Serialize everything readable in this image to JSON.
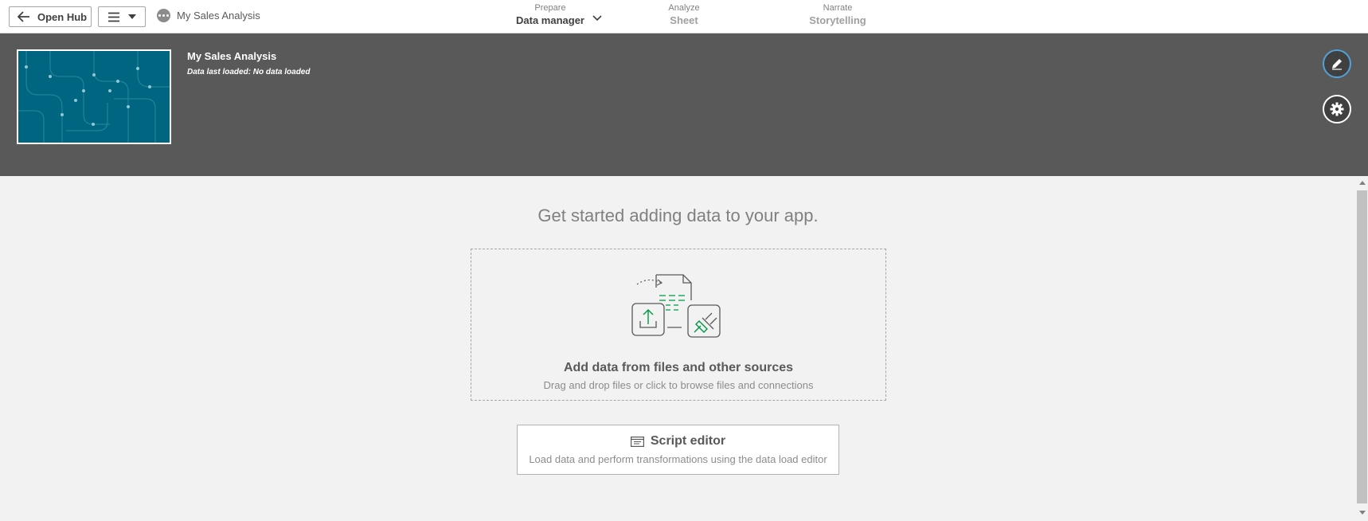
{
  "toolbar": {
    "open_hub_label": "Open Hub",
    "menu_icon": "hamburger-icon",
    "app_name": "My Sales Analysis",
    "nav": [
      {
        "small": "Prepare",
        "label": "Data manager"
      },
      {
        "small": "Analyze",
        "label": "Sheet"
      },
      {
        "small": "Narrate",
        "label": "Storytelling"
      }
    ]
  },
  "header": {
    "title": "My Sales Analysis",
    "subtitle": "Data last loaded: No data loaded",
    "thumbnail_color": "#006580",
    "edit_icon": "pencil-icon",
    "settings_icon": "gear-icon"
  },
  "main": {
    "headline": "Get started adding data to your app.",
    "add_data": {
      "title": "Add data from files and other sources",
      "subtitle": "Drag and drop files or click to browse files and connections"
    },
    "script_editor": {
      "title": "Script editor",
      "subtitle": "Load data and perform transformations using the data load editor"
    }
  },
  "colors": {
    "header_bg": "#595959",
    "accent_green": "#009845",
    "edit_ring": "#52a2d8"
  }
}
